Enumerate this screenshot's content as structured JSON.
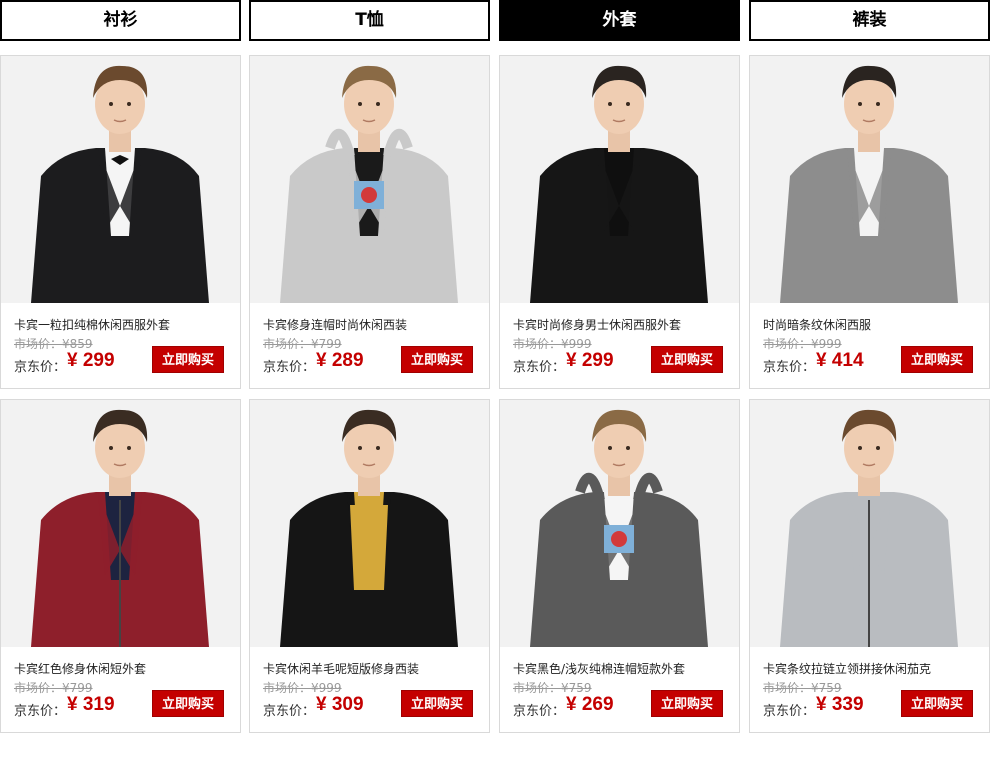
{
  "tabs": [
    {
      "label": "衬衫",
      "active": false
    },
    {
      "label": "T恤",
      "active": false
    },
    {
      "label": "外套",
      "active": true
    },
    {
      "label": "裤装",
      "active": false
    }
  ],
  "labels": {
    "market_price_prefix": "市场价：",
    "jd_price_prefix": "京东价：",
    "buy_button": "立即购买",
    "currency": "¥"
  },
  "products": [
    {
      "name": "卡宾一粒扣纯棉休闲西服外套",
      "market_price": "¥859",
      "price": "¥ 299",
      "jacket_color": "#1c1c1e",
      "inner_color": "#f5f5f5",
      "hair_color": "#6b4a2e",
      "detail": "bowtie"
    },
    {
      "name": "卡宾修身连帽时尚休闲西装",
      "market_price": "¥799",
      "price": "¥ 289",
      "jacket_color": "#c9c9c9",
      "inner_color": "#1a1a1a",
      "hair_color": "#8a6a45",
      "detail": "hood"
    },
    {
      "name": "卡宾时尚修身男士休闲西服外套",
      "market_price": "¥999",
      "price": "¥ 299",
      "jacket_color": "#161616",
      "inner_color": "#0f0f0f",
      "hair_color": "#2a2420",
      "detail": "plain"
    },
    {
      "name": "时尚暗条纹休闲西服",
      "market_price": "¥999",
      "price": "¥ 414",
      "jacket_color": "#8d8d8d",
      "inner_color": "#f3f3f3",
      "hair_color": "#2a2420",
      "detail": "plain"
    },
    {
      "name": "卡宾红色修身休闲短外套",
      "market_price": "¥799",
      "price": "¥ 319",
      "jacket_color": "#8e1f2b",
      "inner_color": "#1d2340",
      "hair_color": "#3a2c22",
      "detail": "zip"
    },
    {
      "name": "卡宾休闲羊毛呢短版修身西装",
      "market_price": "¥999",
      "price": "¥ 309",
      "jacket_color": "#151515",
      "inner_color": "#d4a83a",
      "hair_color": "#3a2c22",
      "detail": "sweater"
    },
    {
      "name": "卡宾黑色/浅灰纯棉连帽短款外套",
      "market_price": "¥759",
      "price": "¥ 269",
      "jacket_color": "#5a5a5a",
      "inner_color": "#f5f5f5",
      "hair_color": "#8a6a45",
      "detail": "hood"
    },
    {
      "name": "卡宾条纹拉链立领拼接休闲茄克",
      "market_price": "¥759",
      "price": "¥ 339",
      "jacket_color": "#b9bcc0",
      "inner_color": "#b9bcc0",
      "hair_color": "#6b4a2e",
      "detail": "zip"
    }
  ]
}
